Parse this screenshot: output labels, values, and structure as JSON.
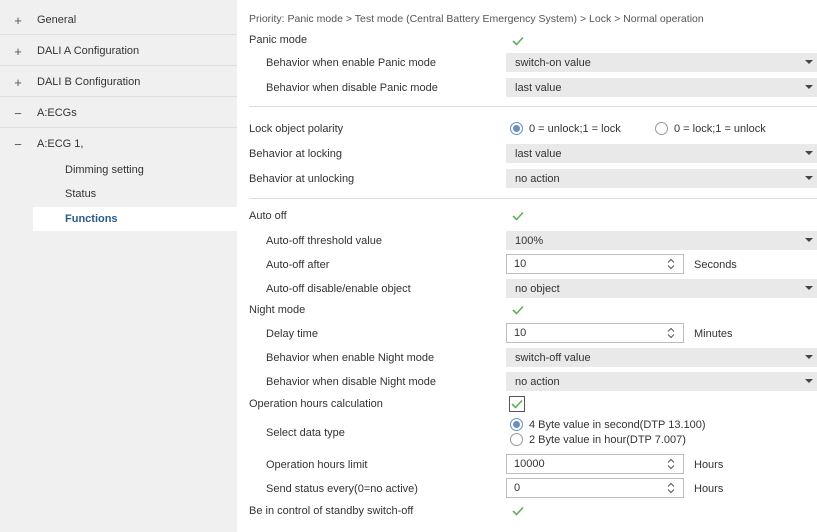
{
  "sidebar": {
    "items": [
      {
        "sign": "+",
        "label": "General"
      },
      {
        "sign": "+",
        "label": "DALI A Configuration"
      },
      {
        "sign": "+",
        "label": "DALI B Configuration"
      },
      {
        "sign": "−",
        "label": "A:ECGs"
      }
    ],
    "ecg": {
      "sign": "−",
      "label": "A:ECG 1,"
    },
    "sub_items": [
      "Dimming setting",
      "Status"
    ],
    "active": "Functions"
  },
  "breadcrumb": "Priority: Panic mode > Test mode (Central Battery Emergency System) > Lock > Normal operation",
  "panic": {
    "label": "Panic mode",
    "enable_label": "Behavior when enable Panic mode",
    "enable_value": "switch-on value",
    "disable_label": "Behavior when disable Panic mode",
    "disable_value": "last value"
  },
  "lock": {
    "polarity_label": "Lock object polarity",
    "polarity_options": [
      "0 = unlock;1 = lock",
      "0 = lock;1 = unlock"
    ],
    "locking_label": "Behavior at locking",
    "locking_value": "last value",
    "unlocking_label": "Behavior at unlocking",
    "unlocking_value": "no action"
  },
  "auto_off": {
    "label": "Auto off",
    "threshold_label": "Auto-off threshold value",
    "threshold_value": "100%",
    "after_label": "Auto-off after",
    "after_value": "10",
    "after_unit": "Seconds",
    "object_label": "Auto-off disable/enable object",
    "object_value": "no object"
  },
  "night": {
    "label": "Night mode",
    "delay_label": "Delay time",
    "delay_value": "10",
    "delay_unit": "Minutes",
    "enable_label": "Behavior when enable Night mode",
    "enable_value": "switch-off value",
    "disable_label": "Behavior when disable Night mode",
    "disable_value": "no action"
  },
  "hours": {
    "label": "Operation hours calculation",
    "type_label": "Select data type",
    "type_options": [
      "4 Byte value in second(DTP 13.100)",
      "2 Byte value in hour(DTP 7.007)"
    ],
    "limit_label": "Operation hours limit",
    "limit_value": "10000",
    "limit_unit": "Hours",
    "send_label": "Send status every(0=no active)",
    "send_value": "0",
    "send_unit": "Hours"
  },
  "standby": {
    "label": "Be in control of standby switch-off"
  },
  "colors": {
    "check": "#5fae5f",
    "active_text": "#2b5b8a",
    "radio_selected": "#6a8fc0"
  }
}
